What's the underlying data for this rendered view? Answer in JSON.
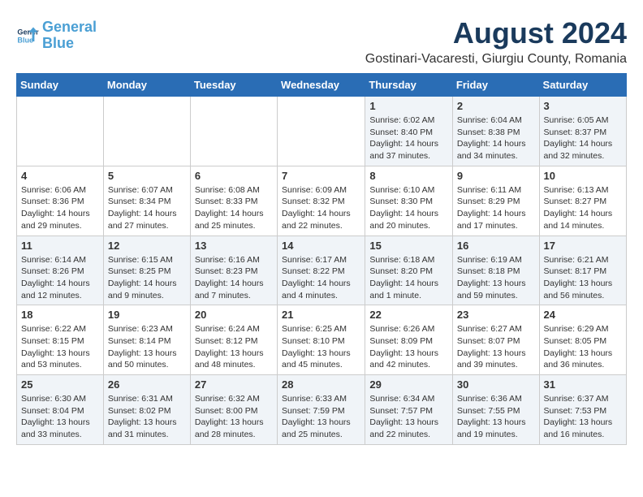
{
  "logo": {
    "line1": "General",
    "line2": "Blue"
  },
  "title": "August 2024",
  "subtitle": "Gostinari-Vacaresti, Giurgiu County, Romania",
  "weekdays": [
    "Sunday",
    "Monday",
    "Tuesday",
    "Wednesday",
    "Thursday",
    "Friday",
    "Saturday"
  ],
  "weeks": [
    [
      {
        "day": "",
        "info": ""
      },
      {
        "day": "",
        "info": ""
      },
      {
        "day": "",
        "info": ""
      },
      {
        "day": "",
        "info": ""
      },
      {
        "day": "1",
        "info": "Sunrise: 6:02 AM\nSunset: 8:40 PM\nDaylight: 14 hours and 37 minutes."
      },
      {
        "day": "2",
        "info": "Sunrise: 6:04 AM\nSunset: 8:38 PM\nDaylight: 14 hours and 34 minutes."
      },
      {
        "day": "3",
        "info": "Sunrise: 6:05 AM\nSunset: 8:37 PM\nDaylight: 14 hours and 32 minutes."
      }
    ],
    [
      {
        "day": "4",
        "info": "Sunrise: 6:06 AM\nSunset: 8:36 PM\nDaylight: 14 hours and 29 minutes."
      },
      {
        "day": "5",
        "info": "Sunrise: 6:07 AM\nSunset: 8:34 PM\nDaylight: 14 hours and 27 minutes."
      },
      {
        "day": "6",
        "info": "Sunrise: 6:08 AM\nSunset: 8:33 PM\nDaylight: 14 hours and 25 minutes."
      },
      {
        "day": "7",
        "info": "Sunrise: 6:09 AM\nSunset: 8:32 PM\nDaylight: 14 hours and 22 minutes."
      },
      {
        "day": "8",
        "info": "Sunrise: 6:10 AM\nSunset: 8:30 PM\nDaylight: 14 hours and 20 minutes."
      },
      {
        "day": "9",
        "info": "Sunrise: 6:11 AM\nSunset: 8:29 PM\nDaylight: 14 hours and 17 minutes."
      },
      {
        "day": "10",
        "info": "Sunrise: 6:13 AM\nSunset: 8:27 PM\nDaylight: 14 hours and 14 minutes."
      }
    ],
    [
      {
        "day": "11",
        "info": "Sunrise: 6:14 AM\nSunset: 8:26 PM\nDaylight: 14 hours and 12 minutes."
      },
      {
        "day": "12",
        "info": "Sunrise: 6:15 AM\nSunset: 8:25 PM\nDaylight: 14 hours and 9 minutes."
      },
      {
        "day": "13",
        "info": "Sunrise: 6:16 AM\nSunset: 8:23 PM\nDaylight: 14 hours and 7 minutes."
      },
      {
        "day": "14",
        "info": "Sunrise: 6:17 AM\nSunset: 8:22 PM\nDaylight: 14 hours and 4 minutes."
      },
      {
        "day": "15",
        "info": "Sunrise: 6:18 AM\nSunset: 8:20 PM\nDaylight: 14 hours and 1 minute."
      },
      {
        "day": "16",
        "info": "Sunrise: 6:19 AM\nSunset: 8:18 PM\nDaylight: 13 hours and 59 minutes."
      },
      {
        "day": "17",
        "info": "Sunrise: 6:21 AM\nSunset: 8:17 PM\nDaylight: 13 hours and 56 minutes."
      }
    ],
    [
      {
        "day": "18",
        "info": "Sunrise: 6:22 AM\nSunset: 8:15 PM\nDaylight: 13 hours and 53 minutes."
      },
      {
        "day": "19",
        "info": "Sunrise: 6:23 AM\nSunset: 8:14 PM\nDaylight: 13 hours and 50 minutes."
      },
      {
        "day": "20",
        "info": "Sunrise: 6:24 AM\nSunset: 8:12 PM\nDaylight: 13 hours and 48 minutes."
      },
      {
        "day": "21",
        "info": "Sunrise: 6:25 AM\nSunset: 8:10 PM\nDaylight: 13 hours and 45 minutes."
      },
      {
        "day": "22",
        "info": "Sunrise: 6:26 AM\nSunset: 8:09 PM\nDaylight: 13 hours and 42 minutes."
      },
      {
        "day": "23",
        "info": "Sunrise: 6:27 AM\nSunset: 8:07 PM\nDaylight: 13 hours and 39 minutes."
      },
      {
        "day": "24",
        "info": "Sunrise: 6:29 AM\nSunset: 8:05 PM\nDaylight: 13 hours and 36 minutes."
      }
    ],
    [
      {
        "day": "25",
        "info": "Sunrise: 6:30 AM\nSunset: 8:04 PM\nDaylight: 13 hours and 33 minutes."
      },
      {
        "day": "26",
        "info": "Sunrise: 6:31 AM\nSunset: 8:02 PM\nDaylight: 13 hours and 31 minutes."
      },
      {
        "day": "27",
        "info": "Sunrise: 6:32 AM\nSunset: 8:00 PM\nDaylight: 13 hours and 28 minutes."
      },
      {
        "day": "28",
        "info": "Sunrise: 6:33 AM\nSunset: 7:59 PM\nDaylight: 13 hours and 25 minutes."
      },
      {
        "day": "29",
        "info": "Sunrise: 6:34 AM\nSunset: 7:57 PM\nDaylight: 13 hours and 22 minutes."
      },
      {
        "day": "30",
        "info": "Sunrise: 6:36 AM\nSunset: 7:55 PM\nDaylight: 13 hours and 19 minutes."
      },
      {
        "day": "31",
        "info": "Sunrise: 6:37 AM\nSunset: 7:53 PM\nDaylight: 13 hours and 16 minutes."
      }
    ]
  ]
}
